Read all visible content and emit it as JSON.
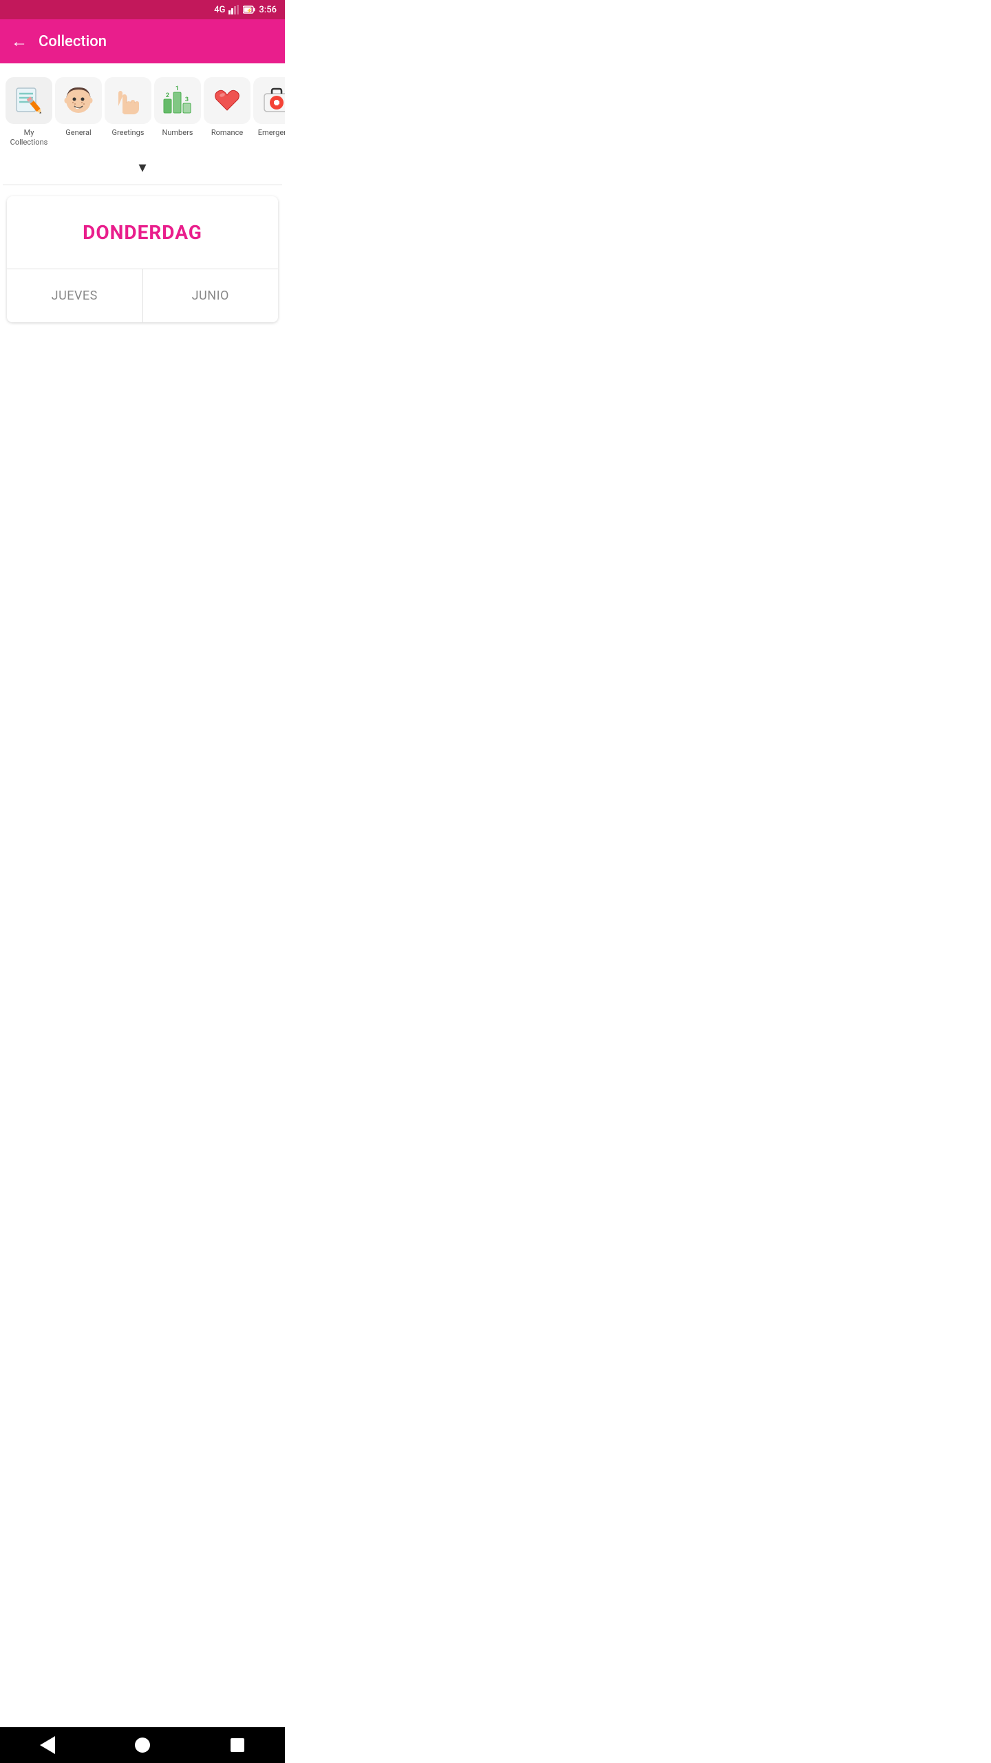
{
  "statusBar": {
    "signal": "4G",
    "battery": "⚡",
    "time": "3:56"
  },
  "appBar": {
    "backLabel": "←",
    "title": "Collection"
  },
  "categories": [
    {
      "id": "my-collections",
      "label": "My Collections",
      "icon": "notebook"
    },
    {
      "id": "general",
      "label": "General",
      "icon": "face"
    },
    {
      "id": "greetings",
      "label": "Greetings",
      "icon": "hand"
    },
    {
      "id": "numbers",
      "label": "Numbers",
      "icon": "numbers"
    },
    {
      "id": "romance",
      "label": "Romance",
      "icon": "heart"
    },
    {
      "id": "emergency",
      "label": "Emergency",
      "icon": "medkit"
    }
  ],
  "chevron": "▾",
  "card": {
    "mainWord": "DONDERDAG",
    "translation1": "JUEVES",
    "translation2": "JUNIO"
  },
  "bottomNav": {
    "back": "back",
    "home": "home",
    "recent": "recent"
  }
}
